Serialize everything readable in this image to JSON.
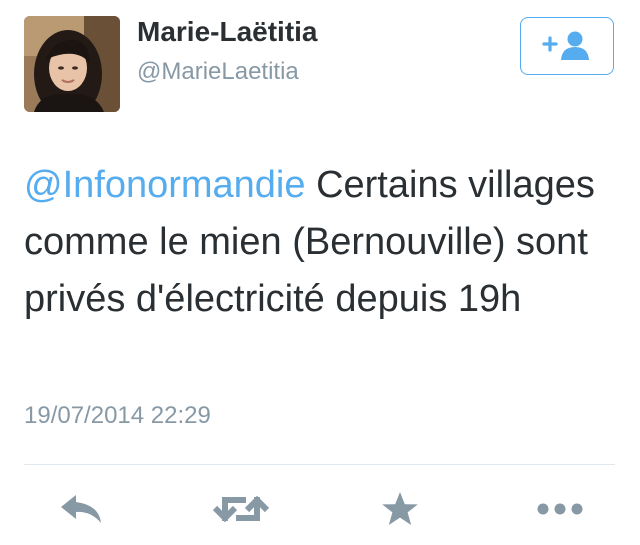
{
  "tweet": {
    "author": {
      "display_name": "Marie-Laëtitia",
      "handle": "@MarieLaetitia",
      "avatar_icon": "profile-photo"
    },
    "text": {
      "mention": "@Infonormandie",
      "body": " Certains villages comme le mien (Bernouville) sont privés d'électricité depuis 19h"
    },
    "timestamp": "19/07/2014 22:29"
  },
  "follow_button": {
    "icon": "add-user-icon",
    "color": "#55acee"
  },
  "actions": [
    {
      "name": "reply",
      "icon": "reply-icon"
    },
    {
      "name": "retweet",
      "icon": "retweet-icon"
    },
    {
      "name": "favorite",
      "icon": "star-icon"
    },
    {
      "name": "more",
      "icon": "more-dots-icon"
    }
  ],
  "colors": {
    "text": "#292f33",
    "secondary": "#8899a6",
    "link": "#55acee",
    "action_icon": "#8899a6",
    "divider": "#e1e8ed"
  }
}
